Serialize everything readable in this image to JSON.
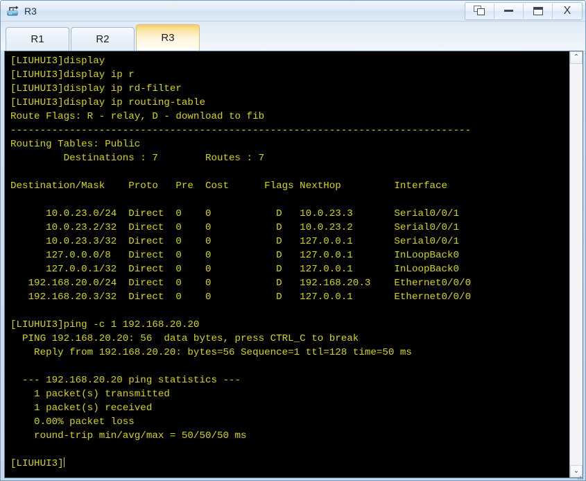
{
  "window": {
    "title": "R3",
    "icon": "router-icon",
    "controls": [
      {
        "name": "restore-windows-button",
        "label": ""
      },
      {
        "name": "minimize-button",
        "label": ""
      },
      {
        "name": "maximize-button",
        "label": ""
      },
      {
        "name": "close-button",
        "label": "X"
      }
    ]
  },
  "tabs": [
    {
      "label": "R1",
      "active": false
    },
    {
      "label": "R2",
      "active": false
    },
    {
      "label": "R3",
      "active": true
    }
  ],
  "terminal": {
    "prompt": "[LIUHUI3]",
    "foreground": "#d7d700",
    "background": "#000000",
    "lines": [
      "[LIUHUI3]display",
      "[LIUHUI3]display ip r",
      "[LIUHUI3]display ip rd-filter",
      "[LIUHUI3]display ip routing-table",
      "Route Flags: R - relay, D - download to fib",
      "------------------------------------------------------------------------------",
      "Routing Tables: Public",
      "         Destinations : 7        Routes : 7",
      "",
      "Destination/Mask    Proto   Pre  Cost      Flags NextHop         Interface",
      "",
      "      10.0.23.0/24  Direct  0    0           D   10.0.23.3       Serial0/0/1",
      "      10.0.23.2/32  Direct  0    0           D   10.0.23.2       Serial0/0/1",
      "      10.0.23.3/32  Direct  0    0           D   127.0.0.1       Serial0/0/1",
      "      127.0.0.0/8   Direct  0    0           D   127.0.0.1       InLoopBack0",
      "      127.0.0.1/32  Direct  0    0           D   127.0.0.1       InLoopBack0",
      "   192.168.20.0/24  Direct  0    0           D   192.168.20.3    Ethernet0/0/0",
      "   192.168.20.3/32  Direct  0    0           D   127.0.0.1       Ethernet0/0/0",
      "",
      "[LIUHUI3]ping -c 1 192.168.20.20",
      "  PING 192.168.20.20: 56  data bytes, press CTRL_C to break",
      "    Reply from 192.168.20.20: bytes=56 Sequence=1 ttl=128 time=50 ms",
      "",
      "  --- 192.168.20.20 ping statistics ---",
      "    1 packet(s) transmitted",
      "    1 packet(s) received",
      "    0.00% packet loss",
      "    round-trip min/avg/max = 50/50/50 ms",
      "",
      "[LIUHUI3]"
    ],
    "routing_table": {
      "flags_legend": "Route Flags: R - relay, D - download to fib",
      "table_name": "Routing Tables: Public",
      "destinations": "7",
      "routes": "7",
      "columns": [
        "Destination/Mask",
        "Proto",
        "Pre",
        "Cost",
        "Flags",
        "NextHop",
        "Interface"
      ],
      "rows": [
        [
          "10.0.23.0/24",
          "Direct",
          "0",
          "0",
          "D",
          "10.0.23.3",
          "Serial0/0/1"
        ],
        [
          "10.0.23.2/32",
          "Direct",
          "0",
          "0",
          "D",
          "10.0.23.2",
          "Serial0/0/1"
        ],
        [
          "10.0.23.3/32",
          "Direct",
          "0",
          "0",
          "D",
          "127.0.0.1",
          "Serial0/0/1"
        ],
        [
          "127.0.0.0/8",
          "Direct",
          "0",
          "0",
          "D",
          "127.0.0.1",
          "InLoopBack0"
        ],
        [
          "127.0.0.1/32",
          "Direct",
          "0",
          "0",
          "D",
          "127.0.0.1",
          "InLoopBack0"
        ],
        [
          "192.168.20.0/24",
          "Direct",
          "0",
          "0",
          "D",
          "192.168.20.3",
          "Ethernet0/0/0"
        ],
        [
          "192.168.20.3/32",
          "Direct",
          "0",
          "0",
          "D",
          "127.0.0.1",
          "Ethernet0/0/0"
        ]
      ]
    },
    "ping": {
      "command": "ping -c 1 192.168.20.20",
      "header": "PING 192.168.20.20: 56  data bytes, press CTRL_C to break",
      "reply": "Reply from 192.168.20.20: bytes=56 Sequence=1 ttl=128 time=50 ms",
      "statistics_title": "--- 192.168.20.20 ping statistics ---",
      "transmitted": "1 packet(s) transmitted",
      "received": "1 packet(s) received",
      "loss": "0.00% packet loss",
      "round_trip": "round-trip min/avg/max = 50/50/50 ms"
    }
  },
  "scrollbar": {
    "up_arrow": "⌃",
    "down_arrow": "⌄"
  }
}
